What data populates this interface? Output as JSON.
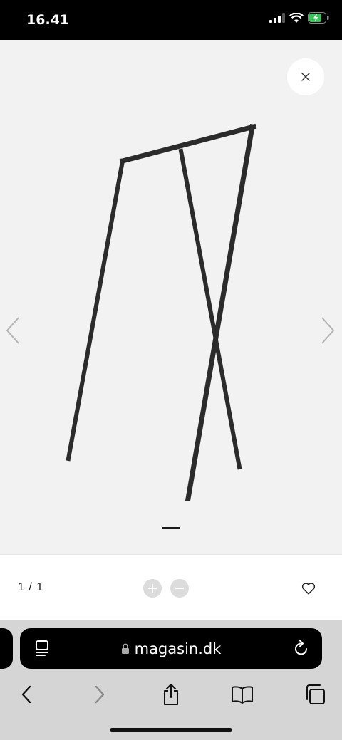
{
  "status_bar": {
    "time": "16.41"
  },
  "viewer": {
    "product_image_alt": "clothes rack",
    "close_label": "×"
  },
  "toolbar": {
    "counter": "1 / 1"
  },
  "browser": {
    "url": "magasin.dk"
  },
  "colors": {
    "frame": "#2b2b2b",
    "background": "#f2f2f2",
    "battery": "#34c759"
  },
  "icons": [
    "signal-icon",
    "wifi-icon",
    "battery-icon",
    "close-icon",
    "chevron-left-icon",
    "chevron-right-icon",
    "zoom-in-icon",
    "zoom-out-icon",
    "heart-icon",
    "reader-icon",
    "lock-icon",
    "reload-icon",
    "back-icon",
    "forward-icon",
    "share-icon",
    "bookmarks-icon",
    "tabs-icon"
  ]
}
